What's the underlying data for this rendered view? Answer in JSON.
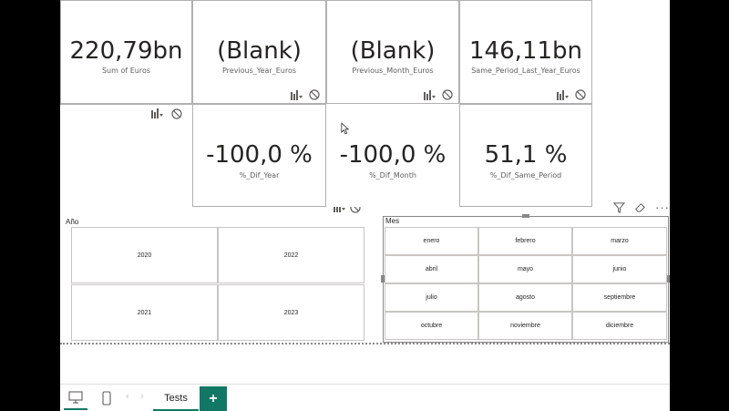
{
  "cards": {
    "sum_euros": {
      "value": "220,79bn",
      "label": "Sum of Euros"
    },
    "prev_year": {
      "value": "(Blank)",
      "label": "Previous_Year_Euros"
    },
    "prev_month": {
      "value": "(Blank)",
      "label": "Previous_Month_Euros"
    },
    "same_period": {
      "value": "146,11bn",
      "label": "Same_Period_Last_Year_Euros"
    },
    "dif_year": {
      "value": "-100,0 %",
      "label": "%_Dif_Year"
    },
    "dif_month": {
      "value": "-100,0 %",
      "label": "%_Dif_Month"
    },
    "dif_same_period": {
      "value": "51,1 %",
      "label": "%_Dif_Same_Period"
    }
  },
  "year_slicer": {
    "title": "Año",
    "items": [
      "2020",
      "2022",
      "2021",
      "2023"
    ]
  },
  "month_slicer": {
    "title": "Mes",
    "items": [
      "enero",
      "febrero",
      "marzo",
      "abril",
      "mayo",
      "junio",
      "julio",
      "agosto",
      "septiembre",
      "octubre",
      "noviembre",
      "diciembre"
    ]
  },
  "visual_header": {
    "more_label": "···"
  },
  "tabs": {
    "nav_prev": "‹",
    "nav_next": "›",
    "page_tab": "Tests",
    "add_label": "+"
  },
  "colors": {
    "accent": "#117865",
    "border": "#c8c6c4",
    "text": "#252423"
  },
  "icons": [
    "drill-bars-icon",
    "no-entry-icon",
    "filter-icon",
    "eraser-icon",
    "more-options-icon",
    "cursor-icon",
    "desktop-view-icon",
    "mobile-view-icon",
    "add-page-icon"
  ]
}
